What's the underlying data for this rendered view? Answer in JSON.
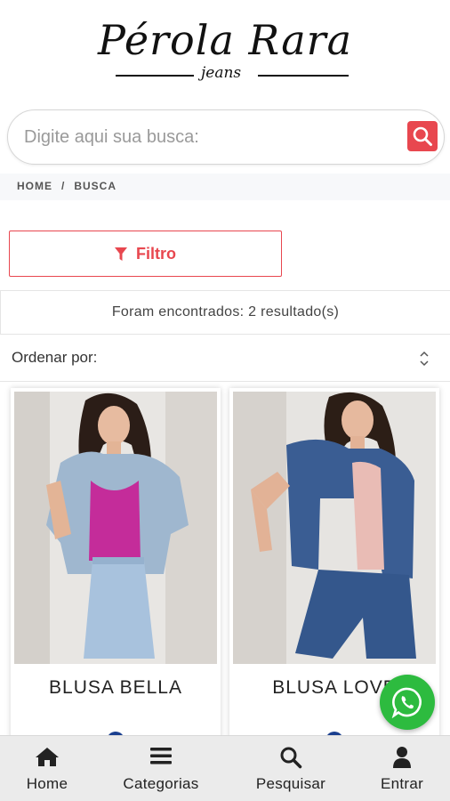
{
  "brand": {
    "name": "Pérola Rara",
    "subtitle": "jeans"
  },
  "search": {
    "placeholder": "Digite aqui sua busca:"
  },
  "breadcrumb": {
    "home": "HOME",
    "separator": "/",
    "current": "BUSCA"
  },
  "filter": {
    "label": "Filtro"
  },
  "results": {
    "text": "Foram encontrados: 2 resultado(s)"
  },
  "sort": {
    "label": "Ordenar por:"
  },
  "products": [
    {
      "name": "BLUSA BELLA",
      "color": "#1a3f8f"
    },
    {
      "name": "BLUSA LOVE",
      "color": "#1a3f8f"
    }
  ],
  "bottom_nav": {
    "home": "Home",
    "categories": "Categorias",
    "search": "Pesquisar",
    "enter": "Entrar"
  },
  "colors": {
    "accent": "#e8474f",
    "whatsapp": "#2dbb3f"
  }
}
